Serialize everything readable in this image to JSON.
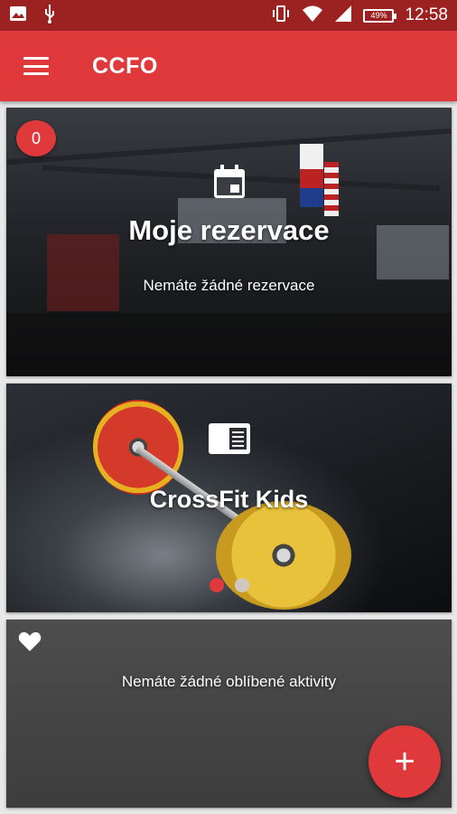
{
  "status_bar": {
    "time": "12:58",
    "battery": "49%",
    "icons": [
      "image-icon",
      "usb-icon",
      "vibrate-icon",
      "wifi-icon",
      "signal-icon",
      "battery-icon"
    ]
  },
  "app_bar": {
    "title": "CCFO",
    "menu_icon": "hamburger-menu-icon",
    "color": "#e0393c"
  },
  "reservations_card": {
    "badge_count": "0",
    "icon": "calendar-icon",
    "title": "Moje rezervace",
    "subtitle": "Nemáte žádné rezervace"
  },
  "carousel_card": {
    "icon": "article-icon",
    "title": "CrossFit Kids",
    "dots": [
      {
        "active": true,
        "color": "#e0393c"
      },
      {
        "active": false,
        "color": "#cfc8c0"
      }
    ]
  },
  "favorites_card": {
    "icon": "heart-icon",
    "message": "Nemáte žádné oblíbené aktivity"
  },
  "fab": {
    "label": "+",
    "icon": "add-icon"
  },
  "colors": {
    "accent": "#e0393c",
    "status_bar": "#9c2222"
  }
}
